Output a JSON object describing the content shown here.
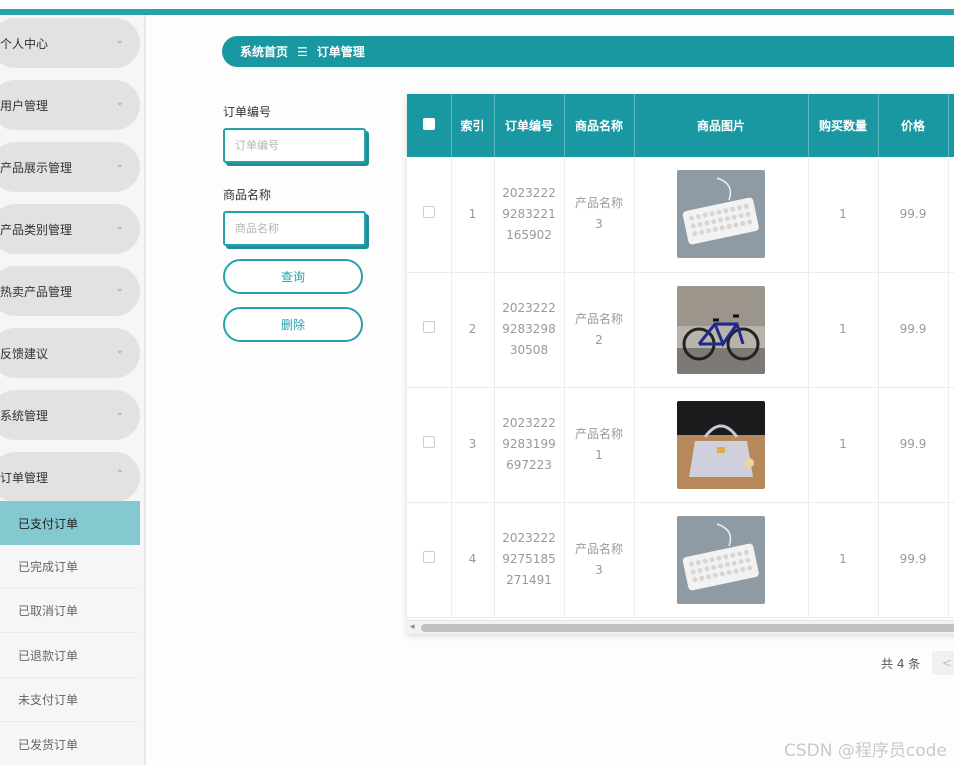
{
  "breadcrumb": {
    "home": "系统首页",
    "separator": "☰",
    "current": "订单管理"
  },
  "sidebar": {
    "menus": [
      {
        "label": "个人中心",
        "chevron": "⌄"
      },
      {
        "label": "用户管理",
        "chevron": "⌄"
      },
      {
        "label": "产品展示管理",
        "chevron": "⌄"
      },
      {
        "label": "产品类别管理",
        "chevron": "⌄"
      },
      {
        "label": "热卖产品管理",
        "chevron": "⌄"
      },
      {
        "label": "反馈建议",
        "chevron": "⌄"
      },
      {
        "label": "系统管理",
        "chevron": "⌄"
      },
      {
        "label": "订单管理",
        "chevron": "⌃"
      }
    ],
    "submenu": [
      {
        "label": "已支付订单",
        "active": true
      },
      {
        "label": "已完成订单"
      },
      {
        "label": "已取消订单"
      },
      {
        "label": "已退款订单"
      },
      {
        "label": "未支付订单"
      },
      {
        "label": "已发货订单"
      }
    ]
  },
  "search": {
    "order_no_label": "订单编号",
    "order_no_placeholder": "订单编号",
    "product_name_label": "商品名称",
    "product_name_placeholder": "商品名称",
    "query_button": "查询",
    "delete_button": "删除"
  },
  "table": {
    "headers": [
      "索引",
      "订单编号",
      "商品名称",
      "商品图片",
      "购买数量",
      "价格"
    ],
    "rows": [
      {
        "index": "1",
        "order_no": "2023222\n9283221\n165902",
        "product": "产品名称\n3",
        "image": "keyboard-photo",
        "qty": "1",
        "price": "99.9"
      },
      {
        "index": "2",
        "order_no": "2023222\n9283298\n30508",
        "product": "产品名称\n2",
        "image": "bicycle-photo",
        "qty": "1",
        "price": "99.9"
      },
      {
        "index": "3",
        "order_no": "2023222\n9283199\n697223",
        "product": "产品名称\n1",
        "image": "handbag-photo",
        "qty": "1",
        "price": "99.9"
      },
      {
        "index": "4",
        "order_no": "2023222\n9275185\n271491",
        "product": "产品名称\n3",
        "image": "keyboard-photo",
        "qty": "1",
        "price": "99.9"
      }
    ]
  },
  "pagination": {
    "total": "共 4 条",
    "prev": "<"
  },
  "watermark": "CSDN @程序员code",
  "colors": {
    "accent": "#1a98a2",
    "active_submenu": "#84c9d0"
  }
}
